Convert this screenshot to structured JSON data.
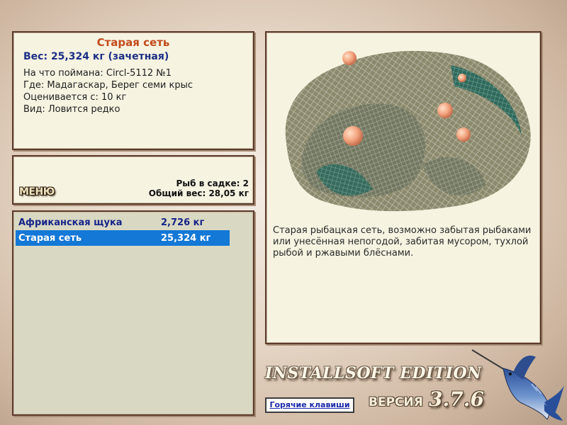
{
  "fish": {
    "title": "Старая сеть",
    "weight": "Вес: 25,324 кг (зачетная)",
    "caught_on": "На что поймана: Circl-5112 №1",
    "where": "Где: Мадагаскар, Берег семи крыс",
    "valued_from": "Оценивается с: 10 кг",
    "type": "Вид: Ловится редко"
  },
  "status": {
    "menu_label": "МЕНЮ",
    "fish_in_keepnet": "Рыб в садке: 2",
    "total_weight": "Общий вес: 28,05 кг"
  },
  "catch_list": [
    {
      "name": "Африканская щука",
      "weight": "2,726 кг",
      "selected": false
    },
    {
      "name": "Старая сеть",
      "weight": "25,324 кг",
      "selected": true
    }
  ],
  "description": "Старая рыбацкая сеть, возможно забытая рыбаками или унесённая непогодой, забитая мусором, тухлой рыбой и ржавыми блёснами.",
  "branding": {
    "edition": "INSTALLSOFT EDITION",
    "version_label": "ВЕРСИЯ",
    "version": "3.7.6",
    "hotkeys_label": "Горячие клавиши"
  },
  "colors": {
    "panel_bg": "#f6f3e1",
    "panel_border": "#5b3b2a",
    "title_accent": "#c24a1a",
    "weight_text": "#1c2f86",
    "selection": "#1378d6"
  },
  "icons": {
    "image": "fishing-net-image",
    "logo": "marlin-icon"
  }
}
